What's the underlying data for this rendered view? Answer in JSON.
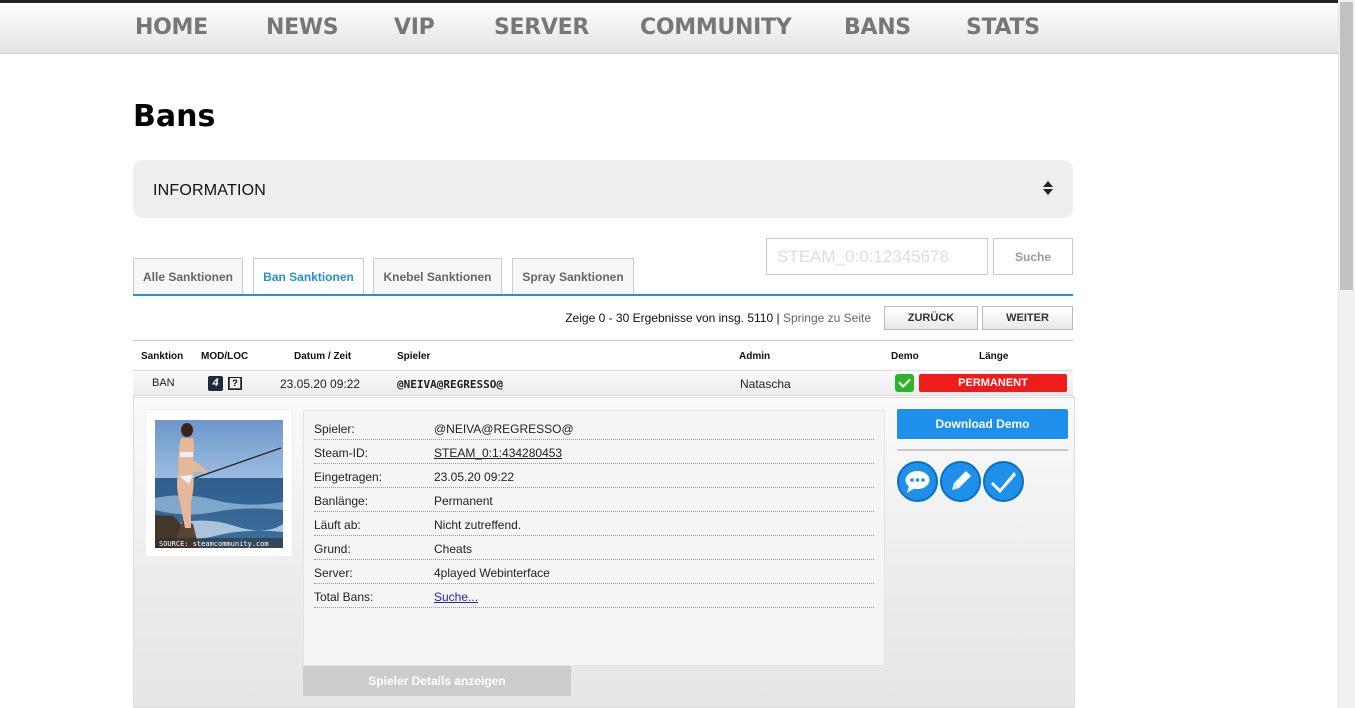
{
  "nav": [
    "HOME",
    "NEWS",
    "VIP",
    "SERVER",
    "COMMUNITY",
    "BANS",
    "STATS"
  ],
  "page_title": "Bans",
  "info_label": "INFORMATION",
  "search": {
    "placeholder": "STEAM_0:0:12345678",
    "button": "Suche"
  },
  "tabs": [
    "Alle Sanktionen",
    "Ban Sanktionen",
    "Knebel Sanktionen",
    "Spray Sanktionen"
  ],
  "active_tab": "Ban Sanktionen",
  "pager": {
    "text": "Zeige 0 - 30 Ergebnisse von insg. 5110",
    "sep": " | ",
    "jump": "Springe zu Seite",
    "prev": "ZURÜCK",
    "next": "WEITER"
  },
  "columns": {
    "sanktion": "Sanktion",
    "modloc": "MOD/LOC",
    "datum": "Datum / Zeit",
    "spieler": "Spieler",
    "admin": "Admin",
    "demo": "Demo",
    "laenge": "Länge"
  },
  "row": {
    "type": "BAN",
    "mod": "4",
    "loc": "?",
    "date": "23.05.20 09:22",
    "player": "@NEIVA@REGRESSO@",
    "admin": "Natascha",
    "length": "PERMANENT",
    "demo_available": true
  },
  "details": [
    {
      "key": "Spieler:",
      "value": "@NEIVA@REGRESSO@"
    },
    {
      "key": "Steam-ID:",
      "value": "STEAM_0:1:434280453"
    },
    {
      "key": "Eingetragen:",
      "value": "23.05.20 09:22"
    },
    {
      "key": "Banlänge:",
      "value": "Permanent"
    },
    {
      "key": "Läuft ab:",
      "value": "Nicht zutreffend."
    },
    {
      "key": "Grund:",
      "value": "Cheats"
    },
    {
      "key": "Server:",
      "value": "4played Webinterface"
    },
    {
      "key": "Total Bans:",
      "value": "Suche..."
    }
  ],
  "avatar_caption": "SOURCE: steamcommunity.com",
  "details_button": "Spieler Details anzeigen",
  "download_demo": "Download Demo",
  "action_icons": [
    "comment-icon",
    "edit-icon",
    "check-icon"
  ],
  "colors": {
    "accent": "#1e90ec",
    "permanent": "#ef1c1c",
    "demo_ok": "#2db42d"
  }
}
